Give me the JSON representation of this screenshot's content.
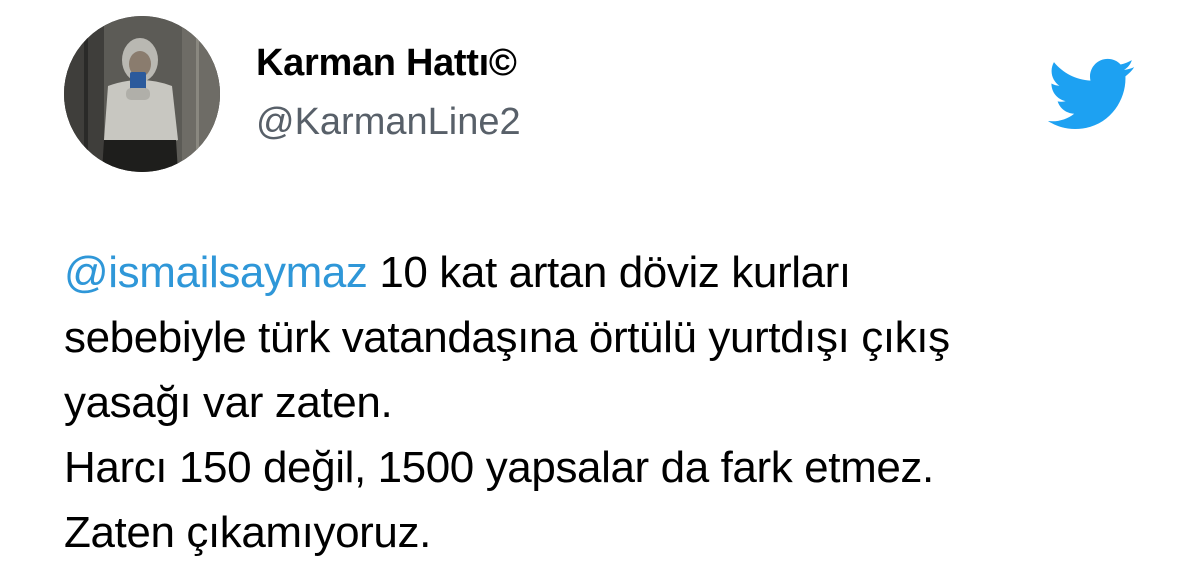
{
  "tweet": {
    "display_name": "Karman Hattı©",
    "handle": "@KarmanLine2",
    "mention": "@ismailsaymaz",
    "text_line1": " 10 kat artan döviz kurları",
    "text_line2": "sebebiyle türk vatandaşına örtülü yurtdışı çıkış",
    "text_line3": "yasağı var zaten.",
    "text_line4": "Harcı 150 değil, 1500 yapsalar da fark etmez.",
    "text_line5": "Zaten çıkamıyoruz."
  },
  "icons": {
    "brand": "twitter-bird-icon",
    "avatar": "profile-photo"
  },
  "colors": {
    "brand_blue": "#1da1f2",
    "mention_blue": "#2f97d8",
    "handle_gray": "#586069",
    "text": "#000000",
    "background": "#ffffff"
  }
}
